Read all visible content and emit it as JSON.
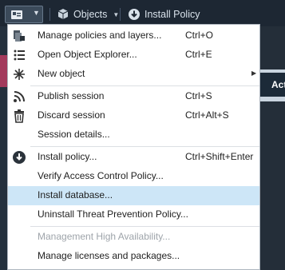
{
  "toolbar": {
    "objects_label": "Objects",
    "install_label": "Install Policy"
  },
  "side_panel": {
    "partial_label": "Act"
  },
  "menu": {
    "items": [
      {
        "label": "Manage policies and layers...",
        "shortcut": "Ctrl+O",
        "icon": "policy-layers-icon"
      },
      {
        "label": "Open Object Explorer...",
        "shortcut": "Ctrl+E",
        "icon": "list-icon"
      },
      {
        "label": "New object",
        "shortcut": "",
        "icon": "new-object-icon",
        "submenu": true
      },
      {
        "label": "Publish session",
        "shortcut": "Ctrl+S",
        "icon": "publish-icon"
      },
      {
        "label": "Discard session",
        "shortcut": "Ctrl+Alt+S",
        "icon": "trash-icon"
      },
      {
        "label": "Session details...",
        "shortcut": ""
      },
      {
        "label": "Install policy...",
        "shortcut": "Ctrl+Shift+Enter",
        "icon": "install-icon"
      },
      {
        "label": "Verify Access Control Policy...",
        "shortcut": ""
      },
      {
        "label": "Install database...",
        "shortcut": "",
        "highlighted": true
      },
      {
        "label": "Uninstall Threat Prevention Policy...",
        "shortcut": ""
      },
      {
        "label": "Management High Availability...",
        "shortcut": "",
        "disabled": true
      },
      {
        "label": "Manage licenses and packages...",
        "shortcut": ""
      }
    ]
  },
  "colors": {
    "toolbar_bg": "#1d2733",
    "menu_bg": "#ffffff",
    "highlight": "#cde6f7",
    "disabled_text": "#9ea4aa"
  }
}
